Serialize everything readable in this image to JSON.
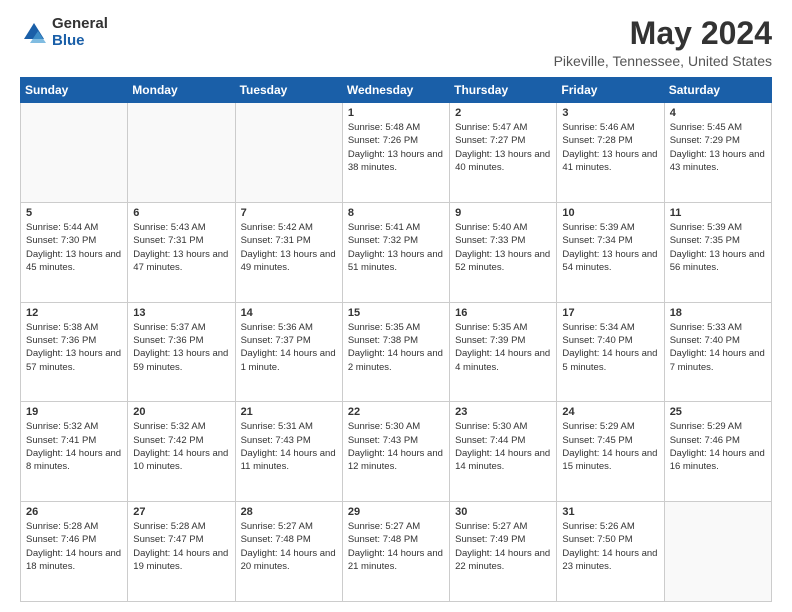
{
  "header": {
    "logo_general": "General",
    "logo_blue": "Blue",
    "month_title": "May 2024",
    "location": "Pikeville, Tennessee, United States"
  },
  "days_of_week": [
    "Sunday",
    "Monday",
    "Tuesday",
    "Wednesday",
    "Thursday",
    "Friday",
    "Saturday"
  ],
  "weeks": [
    [
      {
        "day": "",
        "info": ""
      },
      {
        "day": "",
        "info": ""
      },
      {
        "day": "",
        "info": ""
      },
      {
        "day": "1",
        "info": "Sunrise: 5:48 AM\nSunset: 7:26 PM\nDaylight: 13 hours\nand 38 minutes."
      },
      {
        "day": "2",
        "info": "Sunrise: 5:47 AM\nSunset: 7:27 PM\nDaylight: 13 hours\nand 40 minutes."
      },
      {
        "day": "3",
        "info": "Sunrise: 5:46 AM\nSunset: 7:28 PM\nDaylight: 13 hours\nand 41 minutes."
      },
      {
        "day": "4",
        "info": "Sunrise: 5:45 AM\nSunset: 7:29 PM\nDaylight: 13 hours\nand 43 minutes."
      }
    ],
    [
      {
        "day": "5",
        "info": "Sunrise: 5:44 AM\nSunset: 7:30 PM\nDaylight: 13 hours\nand 45 minutes."
      },
      {
        "day": "6",
        "info": "Sunrise: 5:43 AM\nSunset: 7:31 PM\nDaylight: 13 hours\nand 47 minutes."
      },
      {
        "day": "7",
        "info": "Sunrise: 5:42 AM\nSunset: 7:31 PM\nDaylight: 13 hours\nand 49 minutes."
      },
      {
        "day": "8",
        "info": "Sunrise: 5:41 AM\nSunset: 7:32 PM\nDaylight: 13 hours\nand 51 minutes."
      },
      {
        "day": "9",
        "info": "Sunrise: 5:40 AM\nSunset: 7:33 PM\nDaylight: 13 hours\nand 52 minutes."
      },
      {
        "day": "10",
        "info": "Sunrise: 5:39 AM\nSunset: 7:34 PM\nDaylight: 13 hours\nand 54 minutes."
      },
      {
        "day": "11",
        "info": "Sunrise: 5:39 AM\nSunset: 7:35 PM\nDaylight: 13 hours\nand 56 minutes."
      }
    ],
    [
      {
        "day": "12",
        "info": "Sunrise: 5:38 AM\nSunset: 7:36 PM\nDaylight: 13 hours\nand 57 minutes."
      },
      {
        "day": "13",
        "info": "Sunrise: 5:37 AM\nSunset: 7:36 PM\nDaylight: 13 hours\nand 59 minutes."
      },
      {
        "day": "14",
        "info": "Sunrise: 5:36 AM\nSunset: 7:37 PM\nDaylight: 14 hours\nand 1 minute."
      },
      {
        "day": "15",
        "info": "Sunrise: 5:35 AM\nSunset: 7:38 PM\nDaylight: 14 hours\nand 2 minutes."
      },
      {
        "day": "16",
        "info": "Sunrise: 5:35 AM\nSunset: 7:39 PM\nDaylight: 14 hours\nand 4 minutes."
      },
      {
        "day": "17",
        "info": "Sunrise: 5:34 AM\nSunset: 7:40 PM\nDaylight: 14 hours\nand 5 minutes."
      },
      {
        "day": "18",
        "info": "Sunrise: 5:33 AM\nSunset: 7:40 PM\nDaylight: 14 hours\nand 7 minutes."
      }
    ],
    [
      {
        "day": "19",
        "info": "Sunrise: 5:32 AM\nSunset: 7:41 PM\nDaylight: 14 hours\nand 8 minutes."
      },
      {
        "day": "20",
        "info": "Sunrise: 5:32 AM\nSunset: 7:42 PM\nDaylight: 14 hours\nand 10 minutes."
      },
      {
        "day": "21",
        "info": "Sunrise: 5:31 AM\nSunset: 7:43 PM\nDaylight: 14 hours\nand 11 minutes."
      },
      {
        "day": "22",
        "info": "Sunrise: 5:30 AM\nSunset: 7:43 PM\nDaylight: 14 hours\nand 12 minutes."
      },
      {
        "day": "23",
        "info": "Sunrise: 5:30 AM\nSunset: 7:44 PM\nDaylight: 14 hours\nand 14 minutes."
      },
      {
        "day": "24",
        "info": "Sunrise: 5:29 AM\nSunset: 7:45 PM\nDaylight: 14 hours\nand 15 minutes."
      },
      {
        "day": "25",
        "info": "Sunrise: 5:29 AM\nSunset: 7:46 PM\nDaylight: 14 hours\nand 16 minutes."
      }
    ],
    [
      {
        "day": "26",
        "info": "Sunrise: 5:28 AM\nSunset: 7:46 PM\nDaylight: 14 hours\nand 18 minutes."
      },
      {
        "day": "27",
        "info": "Sunrise: 5:28 AM\nSunset: 7:47 PM\nDaylight: 14 hours\nand 19 minutes."
      },
      {
        "day": "28",
        "info": "Sunrise: 5:27 AM\nSunset: 7:48 PM\nDaylight: 14 hours\nand 20 minutes."
      },
      {
        "day": "29",
        "info": "Sunrise: 5:27 AM\nSunset: 7:48 PM\nDaylight: 14 hours\nand 21 minutes."
      },
      {
        "day": "30",
        "info": "Sunrise: 5:27 AM\nSunset: 7:49 PM\nDaylight: 14 hours\nand 22 minutes."
      },
      {
        "day": "31",
        "info": "Sunrise: 5:26 AM\nSunset: 7:50 PM\nDaylight: 14 hours\nand 23 minutes."
      },
      {
        "day": "",
        "info": ""
      }
    ]
  ]
}
